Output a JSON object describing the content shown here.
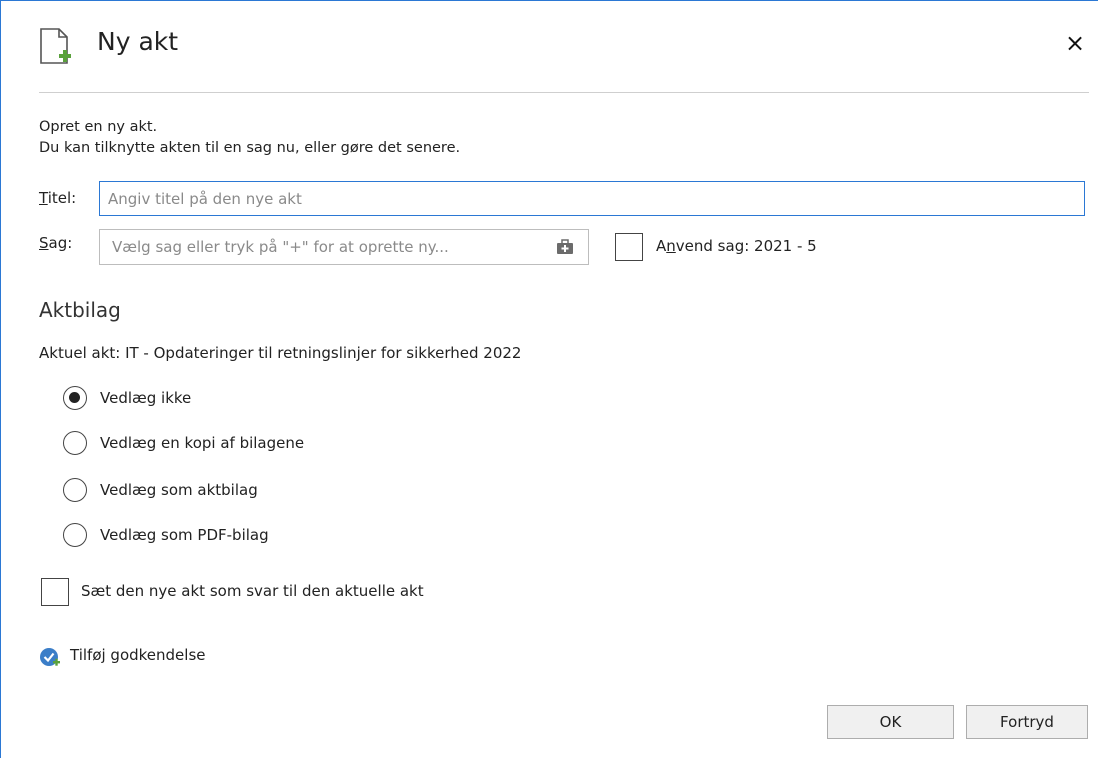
{
  "dialog": {
    "title": "Ny akt",
    "close_glyph": "×",
    "intro_line1": "Opret en ny akt.",
    "intro_line2": "Du kan tilknytte akten til en sag nu, eller gøre det senere."
  },
  "fields": {
    "titel_label": "Titel:",
    "titel_placeholder": "Angiv titel på den nye akt",
    "titel_value": "",
    "sag_label": "Sag:",
    "sag_placeholder": "Vælg sag eller tryk på \"+\" for at oprette ny...",
    "anvend_label": "Anvend sag: 2021 - 5",
    "anvend_checked": false
  },
  "aktbilag": {
    "heading": "Aktbilag",
    "current_act": "Aktuel akt: IT - Opdateringer til retningslinjer for sikkerhed 2022",
    "options": [
      {
        "label": "Vedlæg ikke",
        "selected": true
      },
      {
        "label": "Vedlæg en kopi af bilagene",
        "selected": false
      },
      {
        "label": "Vedlæg som aktbilag",
        "selected": false
      },
      {
        "label": "Vedlæg som PDF-bilag",
        "selected": false
      }
    ]
  },
  "reply": {
    "label": "Sæt den nye akt som svar til den aktuelle akt",
    "checked": false
  },
  "approval": {
    "label": "Tilføj godkendelse",
    "icon": "approval-add-icon"
  },
  "buttons": {
    "ok": "OK",
    "cancel": "Fortryd"
  },
  "icons": {
    "title": "new-document-icon",
    "sag_picker": "case-briefcase-icon"
  },
  "colors": {
    "accent": "#2b78d4",
    "icon_green": "#5aa13c"
  }
}
